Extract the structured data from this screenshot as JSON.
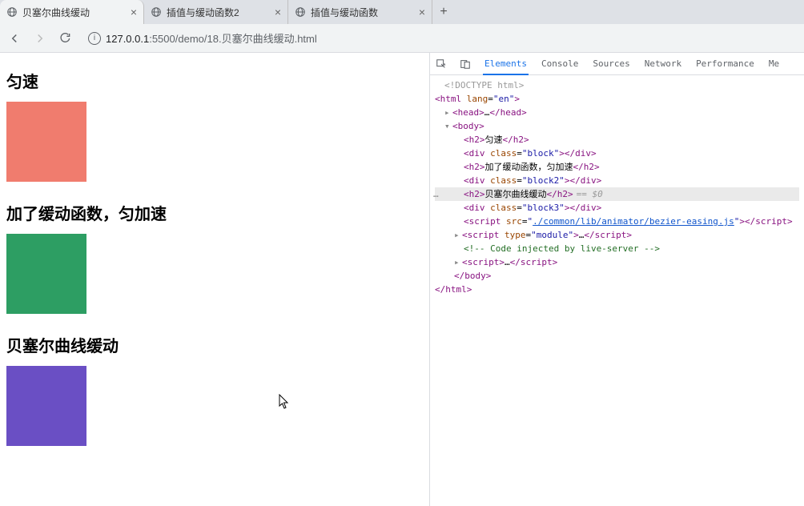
{
  "browser": {
    "tabs": [
      {
        "title": "贝塞尔曲线缓动",
        "active": true
      },
      {
        "title": "插值与缓动函数2",
        "active": false
      },
      {
        "title": "插值与缓动函数",
        "active": false
      }
    ],
    "url_host": "127.0.0.1",
    "url_port": ":5500",
    "url_path": "/demo/18.贝塞尔曲线缓动.html"
  },
  "page": {
    "h1": "匀速",
    "h2": "加了缓动函数，匀加速",
    "h3": "贝塞尔曲线缓动",
    "block_colors": {
      "b1": "#f07c6e",
      "b2": "#2d9e63",
      "b3": "#6a4fc4"
    }
  },
  "devtools": {
    "tabs": [
      "Elements",
      "Console",
      "Sources",
      "Network",
      "Performance",
      "Me"
    ],
    "active_tab": "Elements",
    "selected_hint": "== $0",
    "dom": {
      "doctype": "<!DOCTYPE html>",
      "html_open": "<html lang=\"en\">",
      "head": "<head>…</head>",
      "body_open": "<body>",
      "h2_1_text": "匀速",
      "div1_class": "block",
      "h2_2_text": "加了缓动函数，匀加速",
      "div2_class": "block2",
      "h2_3_text": "贝塞尔曲线缓动",
      "div3_class": "block3",
      "script_src": "./common/lib/animator/bezier-easing.js",
      "script_module": "<script type=\"module\">…</script>",
      "comment": "<!-- Code injected by live-server -->",
      "script_plain": "<script>…</script>",
      "body_close": "</body>",
      "html_close": "</html>"
    }
  }
}
